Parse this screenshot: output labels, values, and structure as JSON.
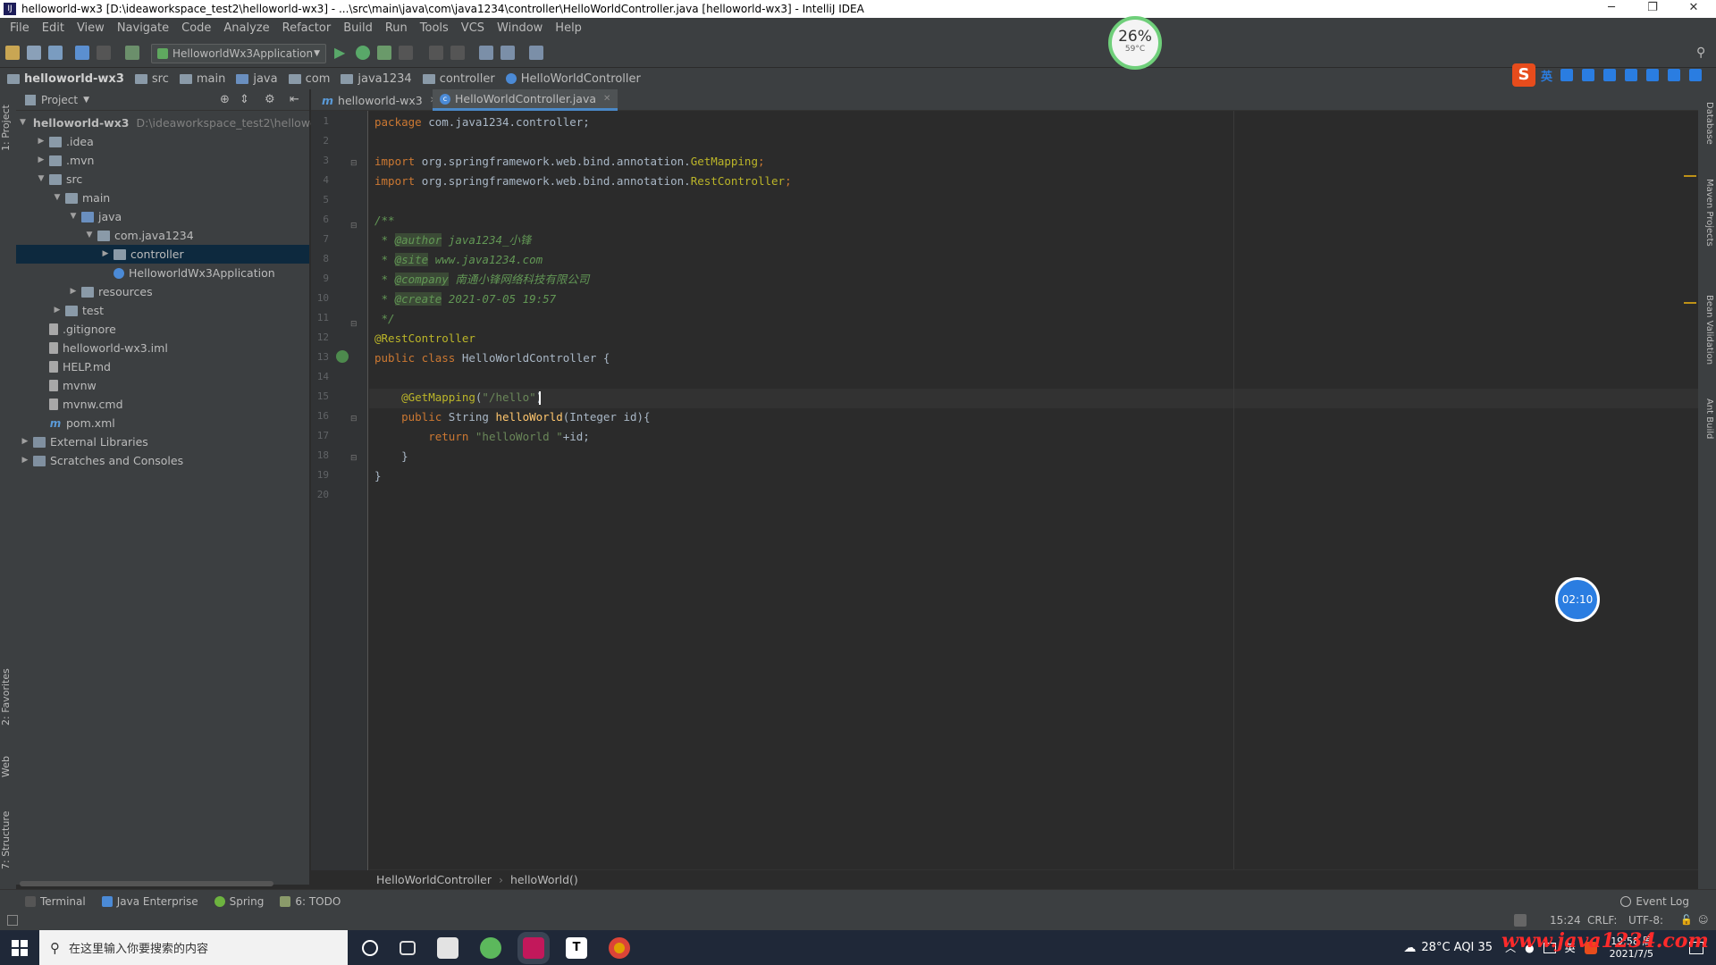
{
  "window": {
    "title": "helloworld-wx3 [D:\\ideaworkspace_test2\\helloworld-wx3] - ...\\src\\main\\java\\com\\java1234\\controller\\HelloWorldController.java [helloworld-wx3] - IntelliJ IDEA",
    "app_icon_label": "IJ"
  },
  "menu": [
    "File",
    "Edit",
    "View",
    "Navigate",
    "Code",
    "Analyze",
    "Refactor",
    "Build",
    "Run",
    "Tools",
    "VCS",
    "Window",
    "Help"
  ],
  "toolbar": {
    "run_config": "HelloworldWx3Application"
  },
  "navbar": {
    "crumbs": [
      "helloworld-wx3",
      "src",
      "main",
      "java",
      "com",
      "java1234",
      "controller",
      "HelloWorldController"
    ]
  },
  "project_panel": {
    "header": "Project",
    "tree": [
      {
        "label": "helloworld-wx3",
        "extra": "D:\\ideaworkspace_test2\\hellowo",
        "icon": "project-folder-icon",
        "level": 0,
        "arrow": "down"
      },
      {
        "label": ".idea",
        "icon": "folder-icon",
        "level": 1,
        "arrow": "right"
      },
      {
        "label": ".mvn",
        "icon": "folder-icon",
        "level": 1,
        "arrow": "right"
      },
      {
        "label": "src",
        "icon": "folder-icon",
        "level": 1,
        "arrow": "down"
      },
      {
        "label": "main",
        "icon": "folder-icon",
        "level": 2,
        "arrow": "down"
      },
      {
        "label": "java",
        "icon": "source-folder-icon",
        "level": 3,
        "arrow": "down"
      },
      {
        "label": "com.java1234",
        "icon": "package-icon",
        "level": 4,
        "arrow": "down"
      },
      {
        "label": "controller",
        "icon": "package-icon",
        "level": 5,
        "arrow": "right",
        "selected": true
      },
      {
        "label": "HelloworldWx3Application",
        "icon": "spring-class-icon",
        "level": 5,
        "arrow": ""
      },
      {
        "label": "resources",
        "icon": "resources-folder-icon",
        "level": 3,
        "arrow": "right"
      },
      {
        "label": "test",
        "icon": "folder-icon",
        "level": 2,
        "arrow": "right"
      },
      {
        "label": ".gitignore",
        "icon": "file-icon",
        "level": 1,
        "arrow": ""
      },
      {
        "label": "helloworld-wx3.iml",
        "icon": "file-icon",
        "level": 1,
        "arrow": ""
      },
      {
        "label": "HELP.md",
        "icon": "markdown-file-icon",
        "level": 1,
        "arrow": ""
      },
      {
        "label": "mvnw",
        "icon": "file-icon",
        "level": 1,
        "arrow": ""
      },
      {
        "label": "mvnw.cmd",
        "icon": "file-icon",
        "level": 1,
        "arrow": ""
      },
      {
        "label": "pom.xml",
        "icon": "maven-file-icon",
        "level": 1,
        "arrow": ""
      },
      {
        "label": "External Libraries",
        "icon": "library-icon",
        "level": 0,
        "arrow": "right"
      },
      {
        "label": "Scratches and Consoles",
        "icon": "scratches-icon",
        "level": 0,
        "arrow": "right"
      }
    ]
  },
  "editor": {
    "tabs": [
      {
        "label": "helloworld-wx3",
        "icon": "m"
      },
      {
        "label": "HelloWorldController.java",
        "icon": "c",
        "active": true
      }
    ],
    "line_numbers": [
      "1",
      "2",
      "3",
      "4",
      "5",
      "6",
      "7",
      "8",
      "9",
      "10",
      "11",
      "12",
      "13",
      "14",
      "15",
      "16",
      "17",
      "18",
      "19",
      "20"
    ],
    "code": {
      "l1_kw": "package ",
      "l1_rest": "com.java1234.controller;",
      "l3_kw": "import ",
      "l3_pkg": "org.springframework.web.bind.annotation.",
      "l3_cls": "GetMapping",
      "l3_end": ";",
      "l4_kw": "import ",
      "l4_pkg": "org.springframework.web.bind.annotation.",
      "l4_cls": "RestController",
      "l4_end": ";",
      "l6": "/**",
      "l7_pre": " * ",
      "l7_tag": "@author",
      "l7_val": " java1234_小锋",
      "l8_pre": " * ",
      "l8_tag": "@site",
      "l8_val": " www.java1234.com",
      "l9_pre": " * ",
      "l9_tag": "@company",
      "l9_val": " 南通小锋网络科技有限公司",
      "l10_pre": " * ",
      "l10_tag": "@create",
      "l10_val": " 2021-07-05 19:57",
      "l11": " */",
      "l12": "@RestController",
      "l13_kw": "public class ",
      "l13_name": "HelloWorldController",
      "l13_end": " {",
      "l15_ann": "    @GetMapping",
      "l15_p1": "(",
      "l15_str": "\"/hello\"",
      "l15_p2": ")",
      "l16_kw": "    public ",
      "l16_type": "String ",
      "l16_fn": "helloWorld",
      "l16_args": "(Integer id){",
      "l17_kw": "        return ",
      "l17_str": "\"helloWorld \"",
      "l17_rest": "+id;",
      "l18": "    }",
      "l19": "}"
    },
    "breadcrumb": [
      "HelloWorldController",
      "helloWorld()"
    ]
  },
  "left_tabs": [
    "1: Project",
    "2: Favorites",
    "Web",
    "7: Structure"
  ],
  "right_tabs": [
    "Database",
    "Maven Projects",
    "Bean Validation",
    "Ant Build"
  ],
  "tool_windows": [
    "Terminal",
    "Java Enterprise",
    "Spring",
    "6: TODO"
  ],
  "event_log": "Event Log",
  "status": {
    "position": "15:24",
    "line_sep": "CRLF:",
    "encoding": "UTF-8:"
  },
  "overlays": {
    "cpu_percent": "26%",
    "cpu_temp": "59°C",
    "timer": "02:10",
    "ime_lang": "英"
  },
  "taskbar": {
    "search_placeholder": "在这里输入你要搜索的内容",
    "weather": "28°C AQI 35",
    "ime": "英",
    "time": "19:58 周",
    "date": "2021/7/5",
    "watermark": "www.java1234.com"
  }
}
